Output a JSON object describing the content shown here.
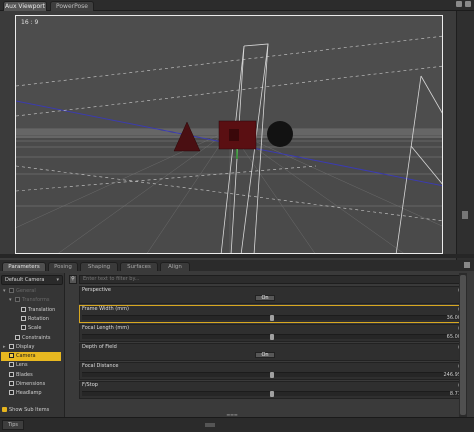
{
  "top_tabs": [
    "Aux Viewport",
    "PowerPose"
  ],
  "viewport": {
    "aspect": "16 : 9",
    "objects": [
      "cone",
      "cube",
      "sphere"
    ],
    "colors": {
      "cone": "#4a0f12",
      "cube": "#5a0f12",
      "sphere": "#121212",
      "grid": "#9a9a9a",
      "horizon_line": "#3a3a9a"
    }
  },
  "panel_tabs": [
    "Parameters",
    "Posing",
    "Shaping",
    "Surfaces",
    "Align"
  ],
  "node_select": "Default Camera",
  "search_placeholder": "Enter text to filter by...",
  "tree": [
    {
      "label": "General",
      "dim": true,
      "indent": 0,
      "twisty": "▾"
    },
    {
      "label": "Transforms",
      "dim": true,
      "indent": 1,
      "twisty": "▾"
    },
    {
      "label": "Translation",
      "indent": 2
    },
    {
      "label": "Rotation",
      "indent": 2
    },
    {
      "label": "Scale",
      "indent": 2
    },
    {
      "label": "Constraints",
      "indent": 1
    },
    {
      "label": "Display",
      "indent": 0,
      "twisty": "▸"
    },
    {
      "label": "Camera",
      "indent": 0,
      "selected": true
    },
    {
      "label": "Lens",
      "indent": 0
    },
    {
      "label": "Blades",
      "indent": 0
    },
    {
      "label": "Dimensions",
      "indent": 0
    },
    {
      "label": "Headlamp",
      "indent": 0
    }
  ],
  "show_sub_items": "Show Sub Items",
  "properties": [
    {
      "name": "Perspective",
      "kind": "toggle",
      "value": "On"
    },
    {
      "name": "Frame Width (mm)",
      "kind": "slider",
      "value": "36.00",
      "fraction": 0.5
    },
    {
      "name": "Focal Length (mm)",
      "kind": "slider",
      "value": "65.00",
      "fraction": 0.5
    },
    {
      "name": "Depth of Field",
      "kind": "toggle",
      "value": "On"
    },
    {
      "name": "Focal Distance",
      "kind": "slider",
      "value": "246.95",
      "fraction": 0.5
    },
    {
      "name": "F/Stop",
      "kind": "slider",
      "value": "8.71",
      "fraction": 0.5
    }
  ],
  "status_tab": "Tips"
}
